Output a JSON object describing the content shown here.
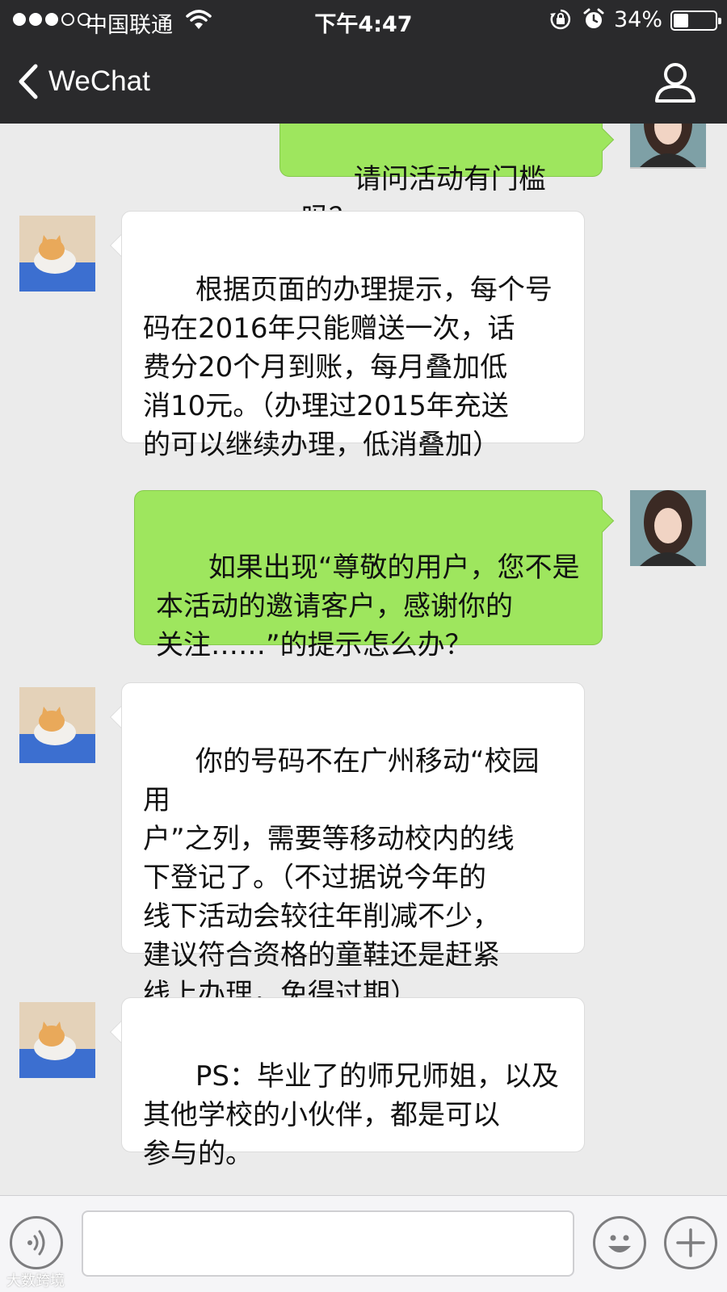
{
  "status_bar": {
    "carrier": "中国联通",
    "time": "下午4:47",
    "battery_percent_label": "34%",
    "battery_level": 0.34,
    "signal_strength": 3
  },
  "nav": {
    "back_label": "WeChat"
  },
  "messages": [
    {
      "sender": "me",
      "text": "请问活动有门槛吗？"
    },
    {
      "sender": "other",
      "text": "根据页面的办理提示，每个号\n码在2016年只能赠送一次，话\n费分20个月到账，每月叠加低\n消10元。（办理过2015年充送\n的可以继续办理，低消叠加）"
    },
    {
      "sender": "me",
      "text": "如果出现“尊敬的用户，您不是\n本活动的邀请客户，感谢你的\n关注……”的提示怎么办？"
    },
    {
      "sender": "other",
      "text": "你的号码不在广州移动“校园用\n户”之列，需要等移动校内的线\n下登记了。（不过据说今年的\n线下活动会较往年削减不少，\n建议符合资格的童鞋还是赶紧\n线上办理，免得过期）"
    },
    {
      "sender": "other",
      "text": "PS：毕业了的师兄师姐，以及\n其他学校的小伙伴，都是可以\n参与的。"
    }
  ],
  "input": {
    "value": ""
  },
  "watermark": "大数跨境",
  "colors": {
    "header_bg": "#2a2a2c",
    "chat_bg": "#ebebeb",
    "bubble_out": "#9ee65e",
    "bubble_in": "#ffffff"
  },
  "icons": {
    "back": "chevron-left-icon",
    "profile": "person-icon",
    "voice": "voice-icon",
    "emoji": "emoji-icon",
    "more": "plus-icon"
  }
}
